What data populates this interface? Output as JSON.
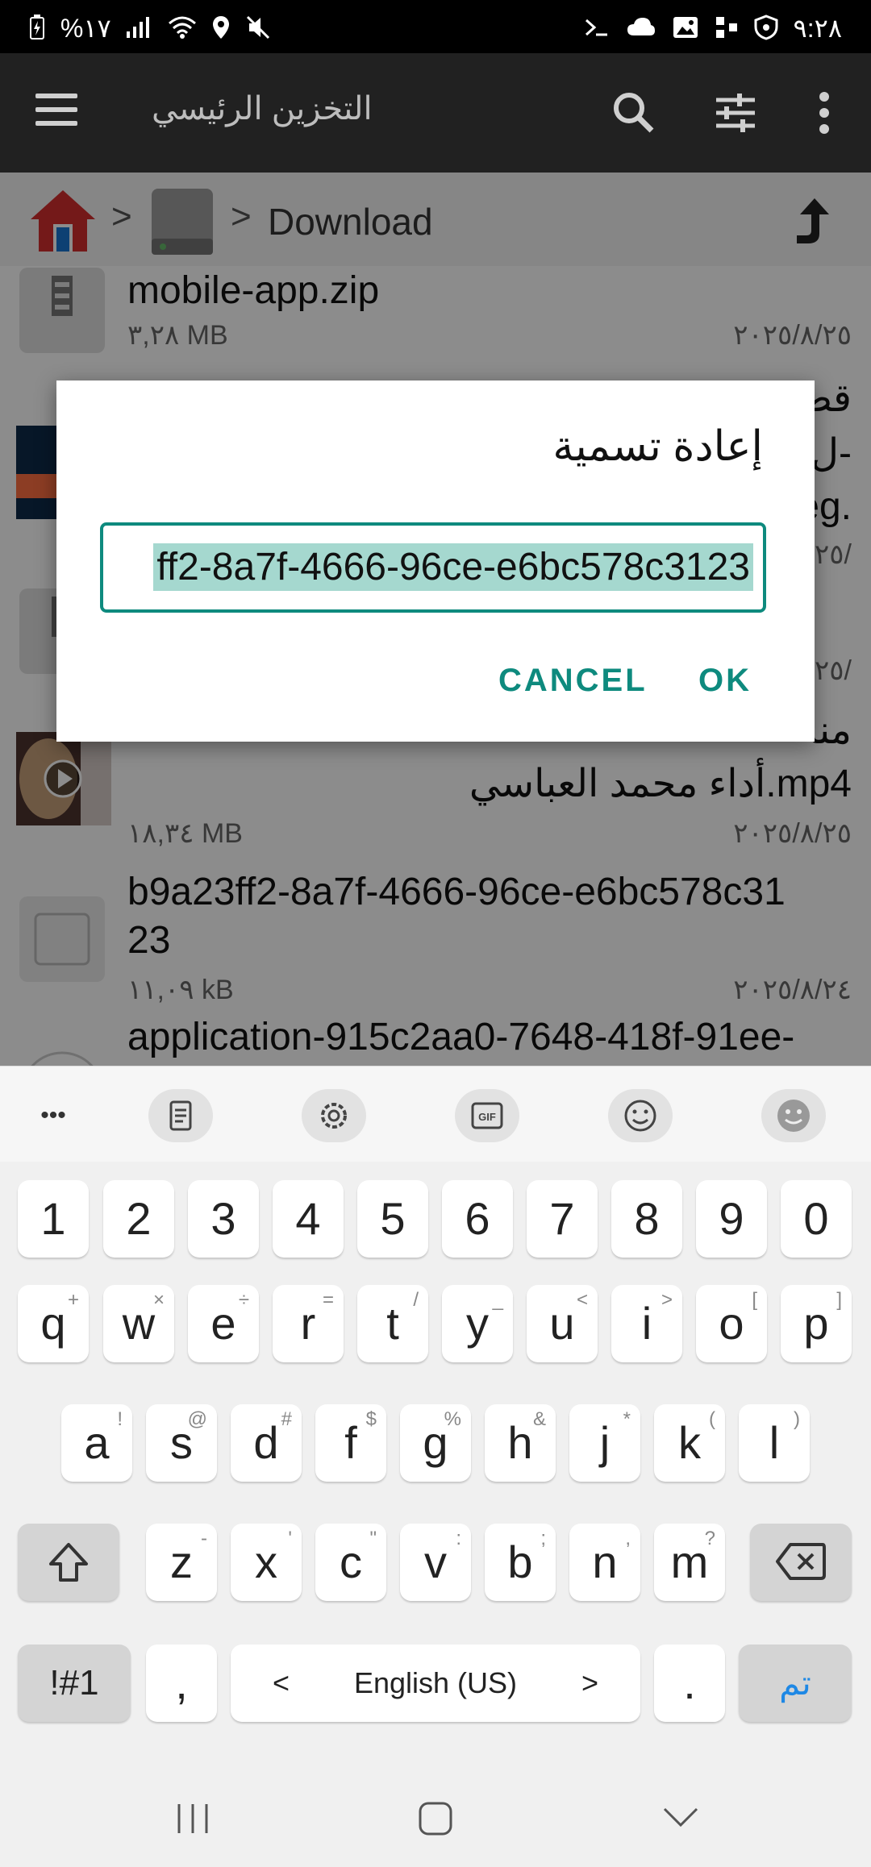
{
  "status": {
    "left": "%١٧",
    "time": "٩:٢٨"
  },
  "appbar": {
    "title": "التخزين الرئيسي",
    "icons": [
      "menu-icon",
      "search-icon",
      "sliders-icon",
      "more-vert-icon"
    ]
  },
  "breadcrumb": {
    "folder": "Download",
    "sep": ">"
  },
  "files": [
    {
      "name": "mobile-app.zip",
      "size": "٣,٢٨ MB",
      "date": "٢٠٢٥/٨/٢٥"
    },
    {
      "name_r1": "قص",
      "name_r2": "ل-",
      "name_r3": "eg.",
      "date": "٢٥/"
    },
    {
      "date": "٢٥/"
    },
    {
      "name_r1": "منا",
      "name_r2": "أداء محمد العباسي.mp4",
      "size": "١٨,٣٤ MB",
      "date": "٢٠٢٥/٨/٢٥"
    },
    {
      "name_l1": "b9a23ff2-8a7f-4666-96ce-e6bc578c31",
      "name_l2": "23",
      "size": "١١,٠٩ kB",
      "date": "٢٠٢٥/٨/٢٤"
    },
    {
      "name_l1": "application-915c2aa0-7648-418f-91ee-"
    }
  ],
  "dialog": {
    "title": "إعادة تسمية",
    "value": "ff2-8a7f-4666-96ce-e6bc578c3123",
    "cancel": "CANCEL",
    "ok": "OK"
  },
  "keyboard": {
    "toolbar_more": "•••",
    "numbers": [
      "1",
      "2",
      "3",
      "4",
      "5",
      "6",
      "7",
      "8",
      "9",
      "0"
    ],
    "row1": [
      "q",
      "w",
      "e",
      "r",
      "t",
      "y",
      "u",
      "i",
      "o",
      "p"
    ],
    "row1_sup": [
      "+",
      "×",
      "÷",
      "=",
      "/",
      "_",
      "<",
      ">",
      "[",
      "]"
    ],
    "row2": [
      "a",
      "s",
      "d",
      "f",
      "g",
      "h",
      "j",
      "k",
      "l"
    ],
    "row2_sup": [
      "!",
      "@",
      "#",
      "$",
      "%",
      "&",
      "*",
      "(",
      ")"
    ],
    "row3": [
      "z",
      "x",
      "c",
      "v",
      "b",
      "n",
      "m"
    ],
    "row3_sup": [
      "-",
      "'",
      "\"",
      ":",
      ";",
      ",",
      "?"
    ],
    "sym": "!#1",
    "comma": ",",
    "space": "English (US)",
    "left": "<",
    "right": ">",
    "period": ".",
    "done": "تم"
  }
}
